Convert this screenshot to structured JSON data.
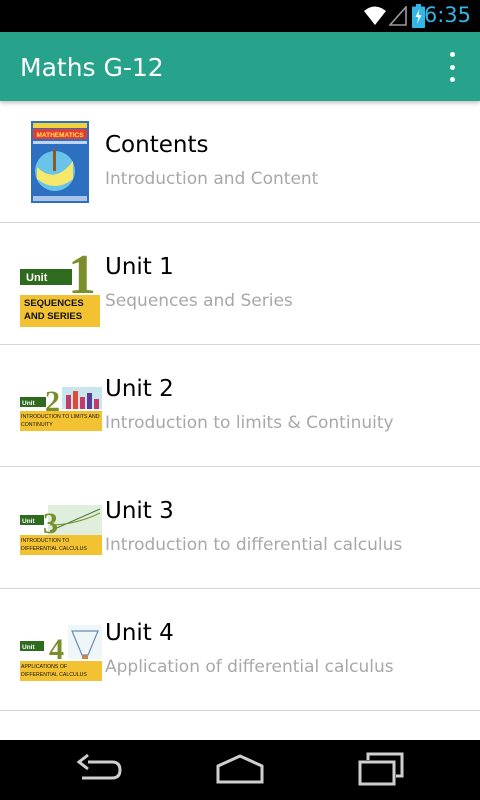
{
  "status_bar": {
    "time": "6:35",
    "battery_level": 0.85
  },
  "app_bar": {
    "title": "Maths G-12"
  },
  "list": [
    {
      "title": "Contents",
      "subtitle": "Introduction and Content",
      "thumb": "book-cover-thumbnail",
      "cover_text": "MATHEMATICS"
    },
    {
      "title": "Unit 1",
      "subtitle": "Sequences and Series",
      "thumb": "unit-1-thumbnail",
      "badge": "Unit",
      "number": "1",
      "caption": [
        "SEQUENCES",
        "AND SERIES"
      ]
    },
    {
      "title": "Unit 2",
      "subtitle": "Introduction to limits & Continuity",
      "thumb": "unit-2-thumbnail",
      "badge": "Unit",
      "number": "2",
      "caption": [
        "INTRODUCTION TO LIMITS AND",
        "CONTINUITY"
      ]
    },
    {
      "title": "Unit 3",
      "subtitle": "Introduction to differential calculus",
      "thumb": "unit-3-thumbnail",
      "badge": "Unit",
      "number": "3",
      "caption": [
        "INTRODUCTION TO",
        "DIFFERENTIAL CALCULUS"
      ]
    },
    {
      "title": "Unit 4",
      "subtitle": "Application of differential calculus",
      "thumb": "unit-4-thumbnail",
      "badge": "Unit",
      "number": "4",
      "caption": [
        "APPLICATIONS OF",
        "DIFFERENTIAL CALCULUS"
      ]
    }
  ],
  "colors": {
    "app_bar": "#26a38a",
    "clock": "#33b5e5",
    "unit_number": "#7a8f2a",
    "caption_band": "#f3c233"
  }
}
